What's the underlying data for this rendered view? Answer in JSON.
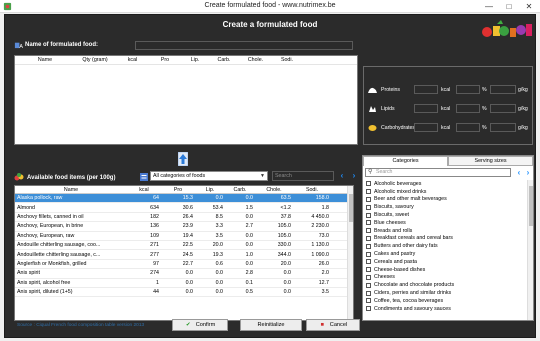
{
  "window": {
    "title": "Create formulated food - www.nutrimex.be"
  },
  "header": {
    "title": "Create a formulated food"
  },
  "name_field": {
    "label": "Name of formulated food:",
    "value": ""
  },
  "composition_table": {
    "columns": [
      "Name",
      "Qty (gram)",
      "kcal",
      "Pro",
      "Lip.",
      "Carb.",
      "Chole.",
      "Sodi."
    ]
  },
  "nutrients": [
    {
      "label": "Proteins",
      "unit1": "kcal",
      "unit2": "%",
      "unit3": "g/kg",
      "icon": "muscle-icon"
    },
    {
      "label": "Lipids",
      "unit1": "kcal",
      "unit2": "%",
      "unit3": "g/kg",
      "icon": "lipid-icon"
    },
    {
      "label": "Carbohydrates",
      "unit1": "kcal",
      "unit2": "%",
      "unit3": "g/kg",
      "icon": "carbohydrate-icon"
    }
  ],
  "available": {
    "label": "Available food items (per 100g)",
    "category_selected": "All categories of foods",
    "search_placeholder": "Search"
  },
  "food_table": {
    "columns": [
      "Name",
      "kcal",
      "Pro",
      "Lip.",
      "Carb.",
      "Chole.",
      "Sodi."
    ],
    "rows": [
      [
        "Alaska pollock, raw",
        "64",
        "15.3",
        "0.0",
        "0.0",
        "63.5",
        "158.0"
      ],
      [
        "Almond",
        "634",
        "30.6",
        "53.4",
        "1.5",
        "<1.2",
        "1.8"
      ],
      [
        "Anchovy fillets, canned in oil",
        "182",
        "26.4",
        "8.5",
        "0.0",
        "37.8",
        "4 450.0"
      ],
      [
        "Anchovy, European, in brine",
        "136",
        "23.9",
        "3.3",
        "2.7",
        "105.0",
        "2 230.0"
      ],
      [
        "Anchovy, European, raw",
        "109",
        "19.4",
        "3.5",
        "0.0",
        "105.0",
        "73.0"
      ],
      [
        "Andouille chitterling sausage, coo...",
        "271",
        "22.5",
        "20.0",
        "0.0",
        "330.0",
        "1 130.0"
      ],
      [
        "Andouillette chitterling sausage, c...",
        "277",
        "24.5",
        "19.3",
        "1.0",
        "344.0",
        "1 090.0"
      ],
      [
        "Anglerfish or Monkfish, grilled",
        "97",
        "22.7",
        "0.6",
        "0.0",
        "20.0",
        "26.0"
      ],
      [
        "Anis spirit",
        "274",
        "0.0",
        "0.0",
        "2.8",
        "0.0",
        "2.0"
      ],
      [
        "Anis spirit, alcohol free",
        "1",
        "0.0",
        "0.0",
        "0.1",
        "0.0",
        "12.7"
      ],
      [
        "Anis spirit, diluted (1+5)",
        "44",
        "0.0",
        "0.0",
        "0.5",
        "0.0",
        "3.5"
      ]
    ]
  },
  "source_note": "Source : Ciqual French food composition table version 2013",
  "categories_panel": {
    "tabs": [
      "Categories",
      "Serving sizes"
    ],
    "search_placeholder": "Search",
    "items": [
      "Alcoholic beverages",
      "Alcoholic mixed drinks",
      "Beer and other malt beverages",
      "Biscuits, savoury",
      "Biscuits, sweet",
      "Blue cheeses",
      "Breads and rolls",
      "Breakfast cereals and cereal bars",
      "Butters and other dairy fats",
      "Cakes and pastry",
      "Cereals and pasta",
      "Cheese-based dishes",
      "Cheeses",
      "Chocolate and chocolate products",
      "Ciders, perries and similar drinks",
      "Coffee, tea, cocoa beverages",
      "Condiments and savoury sauces"
    ]
  },
  "buttons": {
    "confirm": "Confirm",
    "reinitialize": "Reinitialize",
    "cancel": "Cancel"
  },
  "colors": {
    "background": "#2b2b2b",
    "selection": "#3d8fd8",
    "accent": "#1e90ff",
    "source_text": "#2f6ea8"
  }
}
